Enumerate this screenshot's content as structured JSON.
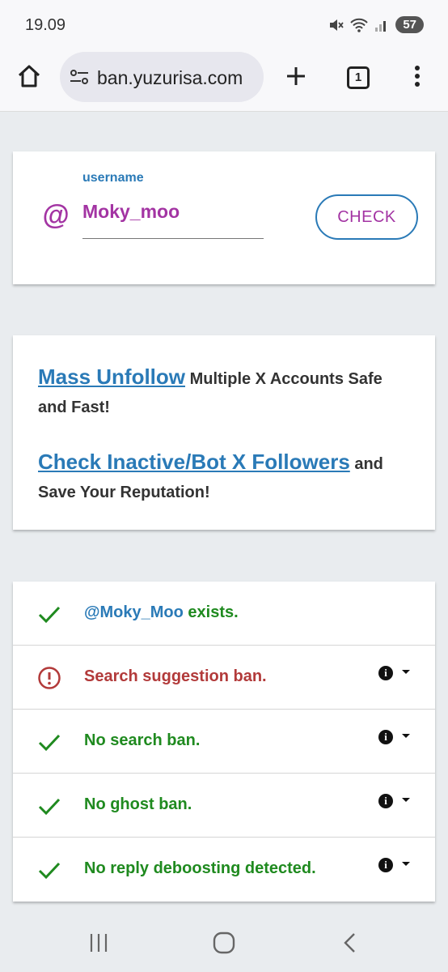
{
  "status_bar": {
    "time": "19.09",
    "battery": "57"
  },
  "browser": {
    "url": "ban.yuzurisa.com",
    "tab_count": "1"
  },
  "check_form": {
    "at_symbol": "@",
    "label": "username",
    "value": "Moky_moo",
    "button": "CHECK"
  },
  "promos": [
    {
      "link": "Mass Unfollow",
      "text": " Multiple X Accounts Safe and Fast!"
    },
    {
      "link": "Check Inactive/Bot X Followers",
      "text": " and Save Your Reputation!"
    }
  ],
  "results": [
    {
      "status": "ok",
      "handle": "@Moky_Moo",
      "text": " exists.",
      "has_info": false
    },
    {
      "status": "ban",
      "text": "Search suggestion ban.",
      "has_info": true
    },
    {
      "status": "ok",
      "text": "No search ban.",
      "has_info": true
    },
    {
      "status": "ok",
      "text": "No ghost ban.",
      "has_info": true
    },
    {
      "status": "ok",
      "text": "No reply deboosting detected.",
      "has_info": true
    }
  ],
  "info_glyph": "i",
  "colors": {
    "accent_blue": "#2a7ab7",
    "accent_purple": "#a334a3",
    "ok_green": "#1f8a1f",
    "ban_red": "#b23a3a"
  }
}
